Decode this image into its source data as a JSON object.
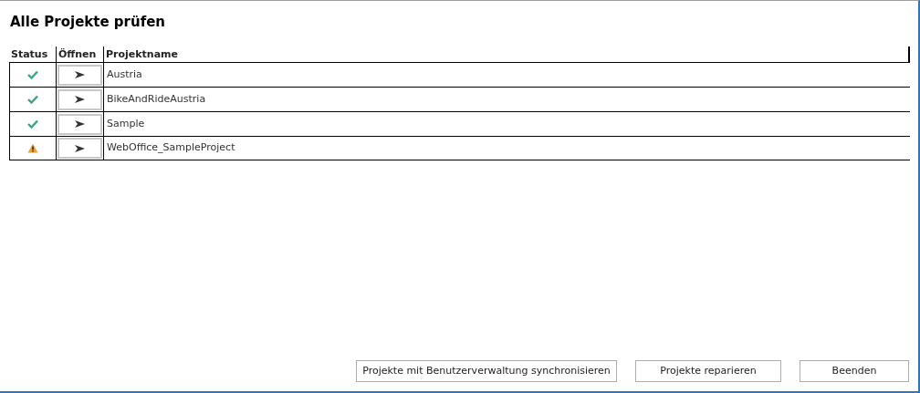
{
  "window": {
    "title": "Alle Projekte prüfen"
  },
  "table": {
    "columns": [
      "Status",
      "Öffnen",
      "Projektname"
    ],
    "rows": [
      {
        "kind": "ok",
        "name": "Austria"
      },
      {
        "kind": "ok",
        "name": "BikeAndRideAustria"
      },
      {
        "kind": "ok",
        "name": "Sample"
      },
      {
        "kind": "warning",
        "name": "WebOffice_SampleProject"
      }
    ]
  },
  "buttons": [
    "Projekte mit Benutzerverwaltung synchronisieren",
    "Projekte reparieren",
    "Beenden"
  ]
}
